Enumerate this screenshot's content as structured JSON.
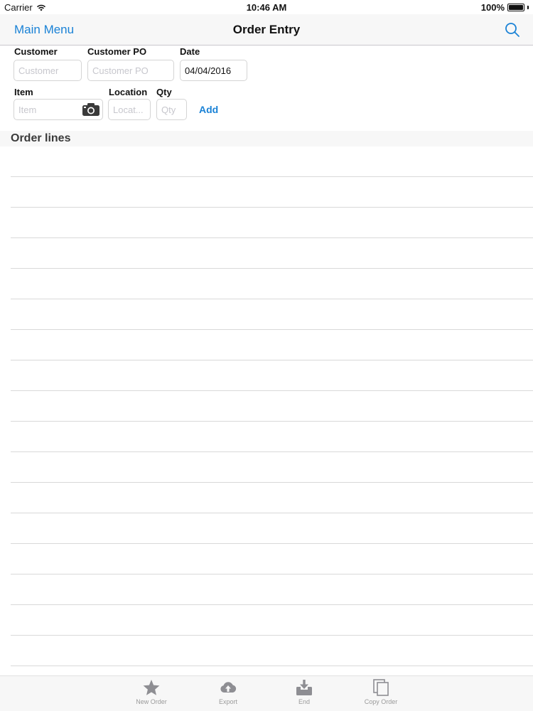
{
  "status_bar": {
    "carrier": "Carrier",
    "time": "10:46 AM",
    "battery": "100%",
    "battery_level": 1.0
  },
  "nav": {
    "back_label": "Main Menu",
    "title": "Order Entry",
    "search_icon": "search-icon",
    "accent_color": "#1a82d6"
  },
  "form": {
    "customer": {
      "label": "Customer",
      "value": "",
      "placeholder": "Customer"
    },
    "customer_po": {
      "label": "Customer PO",
      "value": "",
      "placeholder": "Customer PO"
    },
    "date": {
      "label": "Date",
      "value": "04/04/2016",
      "placeholder": ""
    },
    "item": {
      "label": "Item",
      "value": "",
      "placeholder": "Item",
      "scan_icon": "camera-icon"
    },
    "location": {
      "label": "Location",
      "value": "",
      "placeholder": "Locat..."
    },
    "qty": {
      "label": "Qty",
      "value": "",
      "placeholder": "Qty"
    },
    "add_label": "Add"
  },
  "order_lines": {
    "title": "Order lines",
    "rows": []
  },
  "tab_bar": {
    "tabs": [
      {
        "label": "New Order",
        "icon": "star-icon"
      },
      {
        "label": "Export",
        "icon": "cloud-upload-icon"
      },
      {
        "label": "End",
        "icon": "inbox-download-icon"
      },
      {
        "label": "Copy Order",
        "icon": "copy-icon"
      }
    ]
  }
}
